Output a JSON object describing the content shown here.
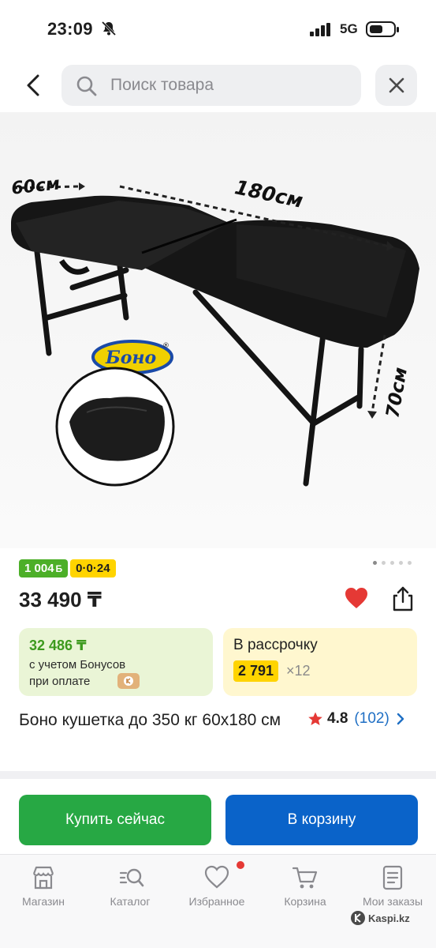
{
  "status_bar": {
    "time": "23:09",
    "network": "5G"
  },
  "search": {
    "placeholder": "Поиск товара"
  },
  "product_image": {
    "brand_logo": "Боно",
    "dim_width": "60см",
    "dim_length": "180см",
    "dim_height": "70см"
  },
  "badges": {
    "bonus": "1 004",
    "bonus_unit": "Б",
    "installment": "0·0·24"
  },
  "price": "33 490 ₸",
  "bonus_card": {
    "amount": "32 486 ₸",
    "line1": "с учетом Бонусов",
    "line2": "при оплате"
  },
  "installment_card": {
    "title": "В рассрочку",
    "monthly": "2 791",
    "months": "×12"
  },
  "product_title": "Боно кушетка до 350 кг 60x180 см",
  "rating": {
    "score": "4.8",
    "reviews": "(102)"
  },
  "actions": {
    "buy_now": "Купить сейчас",
    "add_to_cart": "В корзину"
  },
  "tabbar": [
    {
      "label": "Магазин",
      "icon": "store-icon"
    },
    {
      "label": "Каталог",
      "icon": "catalog-search-icon"
    },
    {
      "label": "Избранное",
      "icon": "heart-outline-icon"
    },
    {
      "label": "Корзина",
      "icon": "cart-icon"
    },
    {
      "label": "Мои заказы",
      "icon": "orders-icon"
    }
  ],
  "watermark": "Kaspi.kz",
  "colors": {
    "bonus_green": "#4caf28",
    "installment_yellow": "#ffd400",
    "buy_green": "#27a844",
    "cart_blue": "#0a63c9",
    "heart_red": "#e53935",
    "link_blue": "#1f6fc4"
  }
}
